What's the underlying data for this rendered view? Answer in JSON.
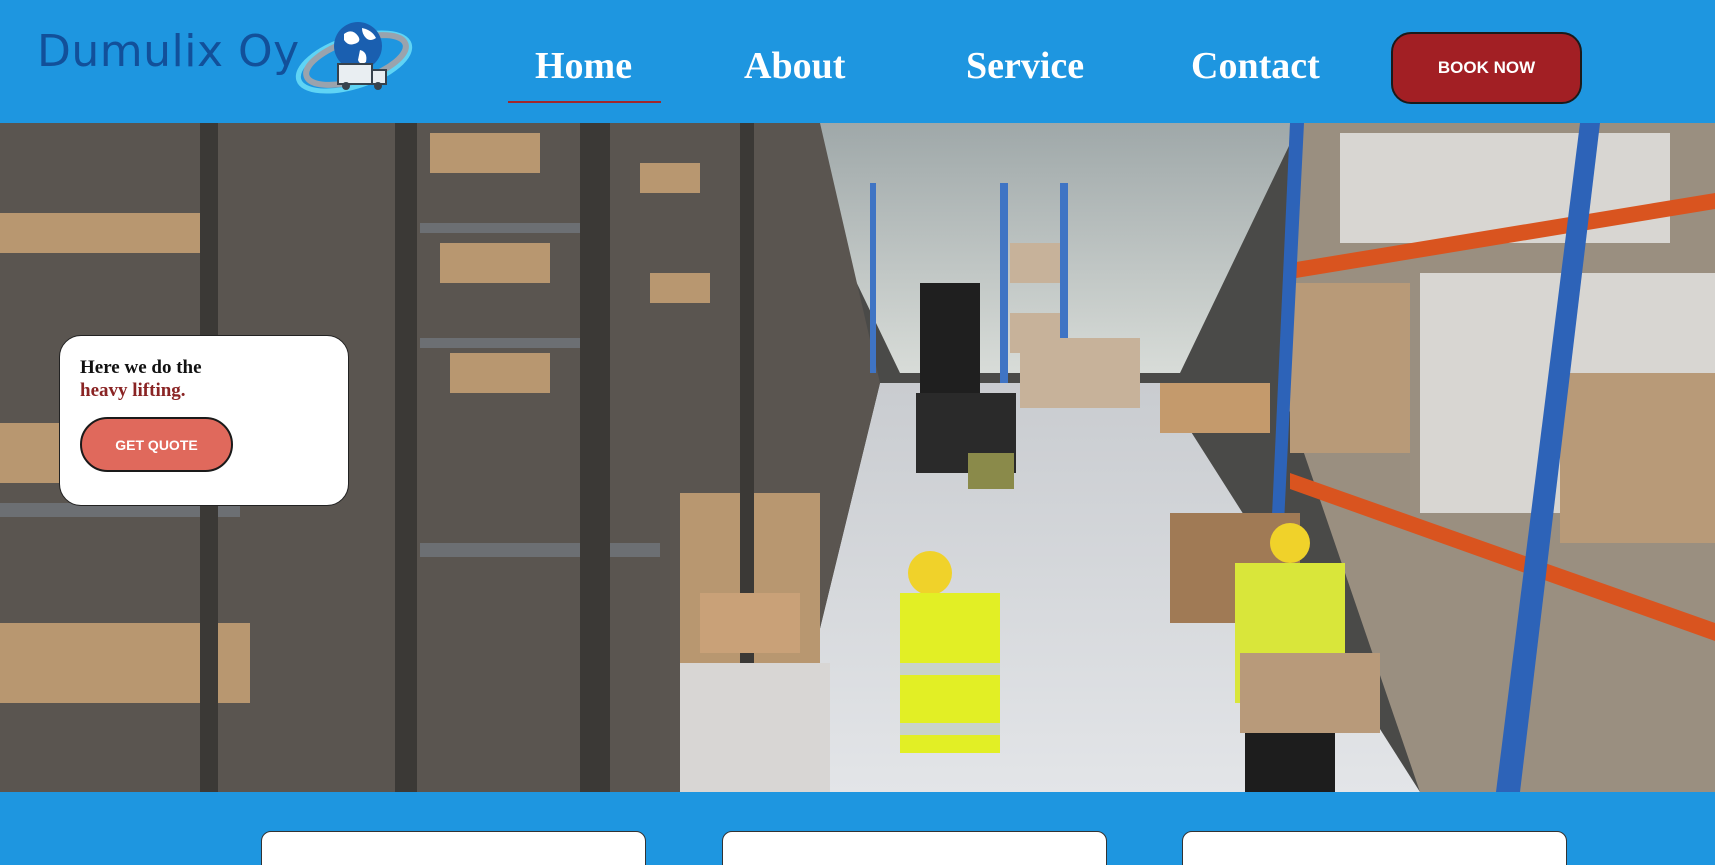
{
  "header": {
    "brand": "Dumulix Oy",
    "logo_icon": "globe-truck-logo-icon",
    "nav": [
      {
        "label": "Home",
        "active": true
      },
      {
        "label": "About",
        "active": false
      },
      {
        "label": "Service",
        "active": false
      },
      {
        "label": "Contact",
        "active": false
      }
    ],
    "book_now": "BOOK NOW"
  },
  "hero": {
    "image": "warehouse-photo",
    "card": {
      "line1": "Here we do the",
      "line2": "heavy lifting.",
      "button": "GET QUOTE"
    }
  },
  "cards_count_visible": 3,
  "colors": {
    "background": "#1e96e0",
    "brand_text": "#12509a",
    "book_button": "#a21f24",
    "quote_button": "#e0695c",
    "accent_text": "#8a2424"
  }
}
